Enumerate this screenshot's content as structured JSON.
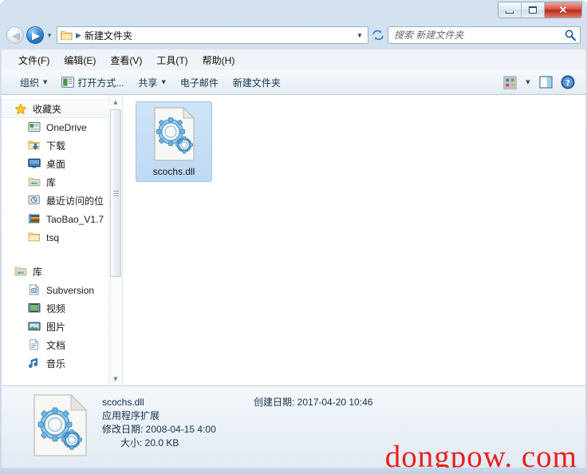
{
  "window": {
    "minimize_label": "最小化",
    "maximize_label": "最大化",
    "close_label": "✕"
  },
  "nav": {
    "back_label": "◀",
    "forward_label": "▶",
    "recent_dropdown_label": "▼",
    "breadcrumb_separator": "▶",
    "breadcrumb": "新建文件夹",
    "address_dropdown_label": "▼",
    "refresh_label": "刷新"
  },
  "search": {
    "placeholder": "搜索 新建文件夹",
    "value": ""
  },
  "menubar": {
    "items": [
      {
        "label": "文件(F)"
      },
      {
        "label": "编辑(E)"
      },
      {
        "label": "查看(V)"
      },
      {
        "label": "工具(T)"
      },
      {
        "label": "帮助(H)"
      }
    ]
  },
  "toolbar": {
    "organize_label": "组织",
    "organize_caret": "▼",
    "open_with_label": "打开方式...",
    "share_label": "共享",
    "share_caret": "▼",
    "email_label": "电子邮件",
    "new_folder_label": "新建文件夹",
    "view_caret": "▼"
  },
  "sidebar": {
    "favorites": {
      "label": "收藏夹",
      "items": [
        {
          "label": "OneDrive",
          "icon": "onedrive-icon"
        },
        {
          "label": "下载",
          "icon": "downloads-icon"
        },
        {
          "label": "桌面",
          "icon": "desktop-icon"
        },
        {
          "label": "库",
          "icon": "library-icon"
        },
        {
          "label": "最近访问的位",
          "icon": "recent-places-icon"
        },
        {
          "label": "TaoBao_V1.7",
          "icon": "archive-icon"
        },
        {
          "label": "tsq",
          "icon": "folder-icon"
        }
      ]
    },
    "libraries": {
      "label": "库",
      "items": [
        {
          "label": "Subversion",
          "icon": "subversion-icon"
        },
        {
          "label": "视频",
          "icon": "videos-icon"
        },
        {
          "label": "图片",
          "icon": "pictures-icon"
        },
        {
          "label": "文档",
          "icon": "documents-icon"
        },
        {
          "label": "音乐",
          "icon": "music-icon"
        }
      ]
    },
    "scroll_up_label": "▲",
    "scroll_down_label": "▼"
  },
  "content": {
    "files": [
      {
        "name": "scochs.dll",
        "selected": true
      }
    ]
  },
  "details": {
    "name": "scochs.dll",
    "type": "应用程序扩展",
    "modified": "修改日期: 2008-04-15 4:00",
    "size": "大小: 20.0 KB",
    "created": "创建日期: 2017-04-20 10:46"
  },
  "watermark": {
    "text": "dongpow. com",
    "color": "#e8201f"
  },
  "colors": {
    "frame": "#c9d9ea",
    "selection": "#bfd9f4",
    "toolbar_text": "#12344f",
    "details_text": "#16314d"
  }
}
